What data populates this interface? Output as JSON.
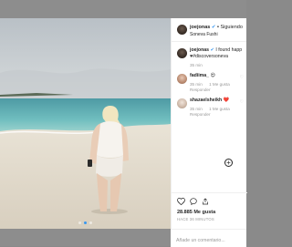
{
  "post": {
    "username": "joejonas",
    "verified_mark": "✔",
    "separator": "•",
    "follow_label": "Siguiendo",
    "location": "Soneva Fushi",
    "image_alt": "Woman standing on a tropical beach by the sea",
    "carousel": {
      "count": 3,
      "active_index": 1
    }
  },
  "comments": [
    {
      "user": "joejonas",
      "verified_mark": "✔",
      "text": "I found happ",
      "text2": "♥#discoversoneva",
      "time": "35 min",
      "likes": "",
      "reply_label": "",
      "avatar": "jj"
    },
    {
      "user": "fadiima_",
      "verified_mark": "",
      "text": "😍",
      "text2": "",
      "time": "35 min",
      "likes": "1 Me gusta",
      "reply_label": "Responder",
      "avatar": "fa"
    },
    {
      "user": "shazaelsheikh",
      "verified_mark": "",
      "text": "❤️",
      "text2": "",
      "time": "35 min",
      "likes": "1 Me gusta",
      "reply_label": "Responder",
      "avatar": "sh"
    }
  ],
  "load_more_label": "+",
  "actions": {
    "icons": [
      "heart-icon",
      "comment-icon",
      "share-icon"
    ],
    "likes": "28.885 Me gusta",
    "time_ago": "HACE 36 MINUTOS"
  },
  "add_comment": {
    "placeholder": "Añade un comentario..."
  },
  "colors": {
    "accent": "#3897f0",
    "backdrop": "#8d8d8d",
    "muted": "#999999"
  }
}
